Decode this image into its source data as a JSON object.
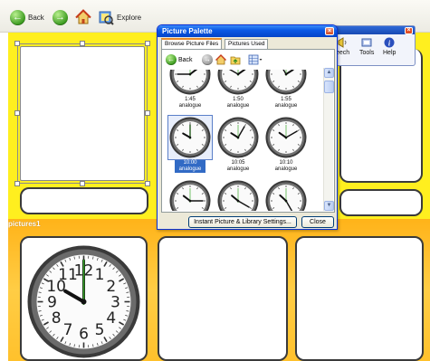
{
  "toolbar": {
    "back_label": "Back",
    "explore_label": "Explore"
  },
  "right_toolbar": {
    "items": [
      "eech",
      "Tools",
      "Help"
    ]
  },
  "picture_palette": {
    "title": "Picture Palette",
    "tabs": [
      "Browse Picture Files",
      "Pictures Used"
    ],
    "back_label": "Back",
    "clocks": [
      {
        "label": "1:45 analogue",
        "hour": 1,
        "minute": 45,
        "selected": false
      },
      {
        "label": "1:50 analogue",
        "hour": 1,
        "minute": 50,
        "selected": false
      },
      {
        "label": "1:55 analogue",
        "hour": 1,
        "minute": 55,
        "selected": false
      },
      {
        "label": "10:00 analogue",
        "hour": 10,
        "minute": 0,
        "selected": true
      },
      {
        "label": "10:05 analogue",
        "hour": 10,
        "minute": 5,
        "selected": false
      },
      {
        "label": "10:10 analogue",
        "hour": 10,
        "minute": 10,
        "selected": false
      },
      {
        "label": "",
        "hour": 10,
        "minute": 15,
        "selected": false
      },
      {
        "label": "",
        "hour": 10,
        "minute": 20,
        "selected": false
      },
      {
        "label": "",
        "hour": 10,
        "minute": 25,
        "selected": false
      }
    ],
    "settings_button": "Instant Picture & Library Settings...",
    "close_button": "Close"
  },
  "bottom_strip": {
    "label": "pictures1",
    "clock": {
      "hour": 10,
      "minute": 0
    },
    "dial_numbers": [
      "11",
      "12",
      "1",
      "2",
      "3",
      "4",
      "5",
      "6",
      "7",
      "8",
      "9",
      "10"
    ]
  },
  "colors": {
    "page_yellow": "#ffef1f",
    "strip_orange": "#ffc12c",
    "dialog_blue": "#0b5ae6",
    "selection_blue": "#316ac5"
  }
}
